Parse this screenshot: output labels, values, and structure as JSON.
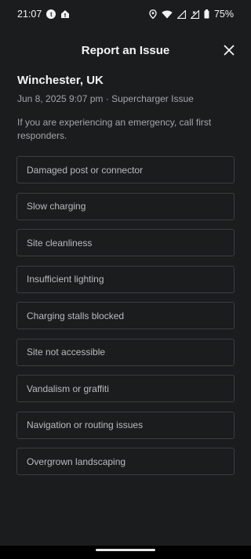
{
  "status_bar": {
    "time": "21:07",
    "battery": "75%",
    "icons": [
      "app-t-icon",
      "home-alert-icon",
      "location-icon",
      "wifi-icon",
      "signal-icon",
      "signal-x-icon",
      "battery-icon"
    ]
  },
  "header": {
    "title": "Report an Issue",
    "close_icon": "close-icon"
  },
  "site": {
    "location": "Winchester, UK",
    "meta": "Jun 8, 2025 9:07 pm · Supercharger Issue"
  },
  "notice": "If you are experiencing an emergency, call first responders.",
  "options": [
    {
      "label": "Damaged post or connector"
    },
    {
      "label": "Slow charging"
    },
    {
      "label": "Site cleanliness"
    },
    {
      "label": "Insufficient lighting"
    },
    {
      "label": "Charging stalls blocked"
    },
    {
      "label": "Site not accessible"
    },
    {
      "label": "Vandalism or graffiti"
    },
    {
      "label": "Navigation or routing issues"
    },
    {
      "label": "Overgrown landscaping"
    }
  ],
  "colors": {
    "background": "#1b1c1e",
    "border": "#3c3d40",
    "primary_text": "#f4f4f4",
    "secondary_text": "#a3a5a8"
  }
}
